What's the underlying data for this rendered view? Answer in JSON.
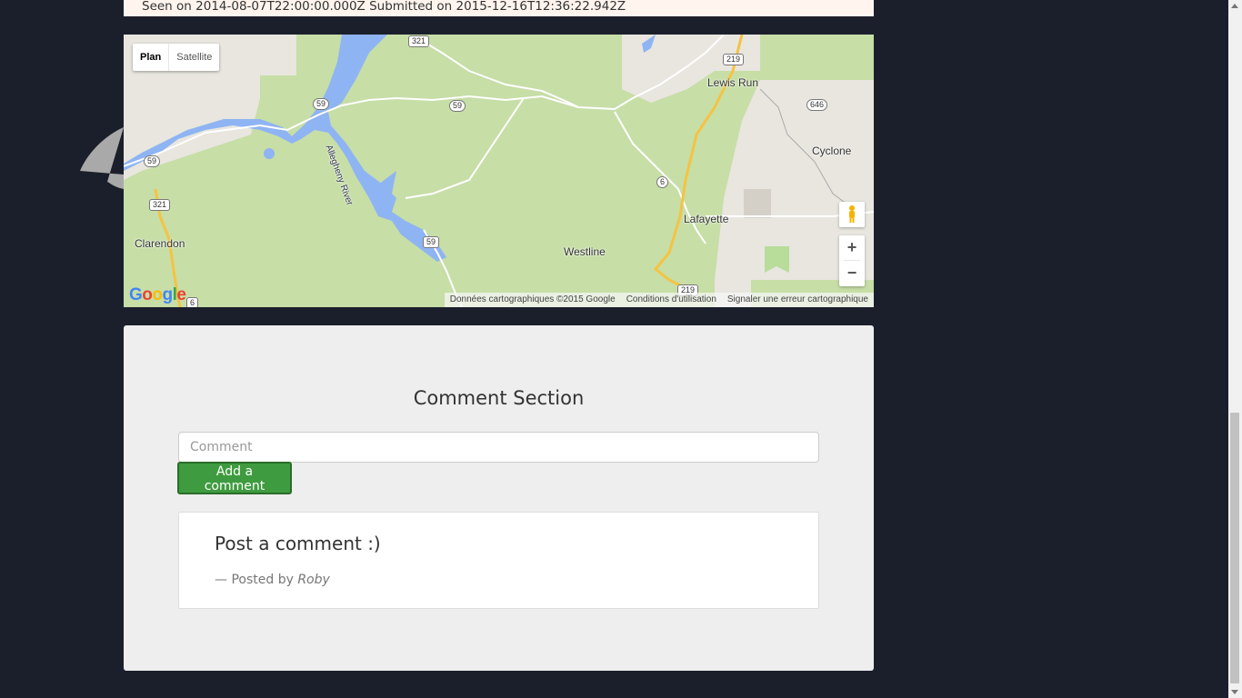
{
  "sighting": {
    "seen_text": "Seen on 2014-08-07T22:00:00.000Z Submitted on 2015-12-16T12:36:22.942Z"
  },
  "map": {
    "type_controls": {
      "plan": "Plan",
      "satellite": "Satellite",
      "selected": "Plan"
    },
    "zoom": {
      "in": "+",
      "out": "−"
    },
    "places": [
      "Lewis Run",
      "Cyclone",
      "Lafayette",
      "Westline",
      "Clarendon"
    ],
    "river_label": "Allegheny River",
    "route_shields": [
      "321",
      "219",
      "59",
      "646",
      "59",
      "59",
      "6",
      "321",
      "59",
      "219",
      "6",
      "5"
    ],
    "logo": "Google",
    "footer": {
      "data": "Données cartographiques ©2015 Google",
      "terms": "Conditions d'utilisation",
      "report": "Signaler une erreur cartographique"
    },
    "colors": {
      "land": "#c7dea7",
      "water": "#8fb4f3",
      "road": "#ffffff",
      "highway": "#f5c343"
    }
  },
  "comments": {
    "title": "Comment Section",
    "input_placeholder": "Comment",
    "input_value": "",
    "add_button": "Add a comment",
    "items": [
      {
        "text": "Post a comment :)",
        "posted_by_prefix": "— Posted by",
        "author": "Roby"
      }
    ],
    "colors": {
      "button": "#3f9b3f",
      "panel": "#eeeeee"
    }
  }
}
